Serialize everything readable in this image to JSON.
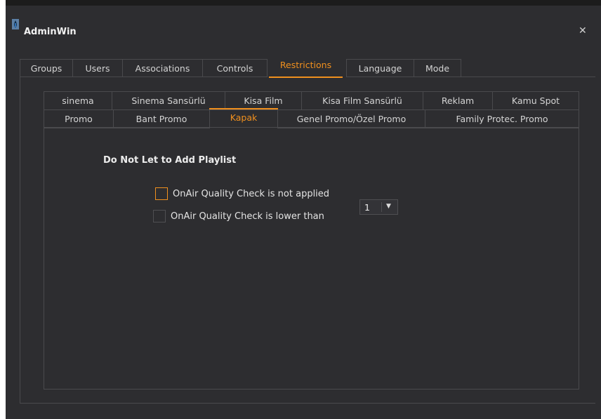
{
  "window": {
    "title": "AdminWin",
    "close_icon": "close-icon"
  },
  "main_tabs": [
    "Groups",
    "Users",
    "Associations",
    "Controls",
    "Restrictions",
    "Language",
    "Mode"
  ],
  "active_main_tab": "Restrictions",
  "sub_tabs_row1": [
    "sinema",
    "Sinema Sansürlü",
    "Kisa Film",
    "Kisa Film Sansürlü",
    "Reklam",
    "Kamu Spot"
  ],
  "sub_tabs_row2": [
    "Promo",
    "Bant Promo",
    "Kapak",
    "Genel Promo/Özel Promo",
    "Family Protec. Promo"
  ],
  "active_sub_tab": "Kapak",
  "content": {
    "heading": "Do Not Let to Add Playlist",
    "checkbox1_label": "OnAir Quality Check is not applied",
    "checkbox1_checked": false,
    "checkbox2_label": "OnAir Quality Check is lower than",
    "checkbox2_checked": false,
    "quality_select": {
      "value": "1"
    }
  },
  "colors": {
    "accent": "#f0901e",
    "background": "#2d2d30",
    "border": "#4a4a4d",
    "text": "#dcdcdc"
  }
}
